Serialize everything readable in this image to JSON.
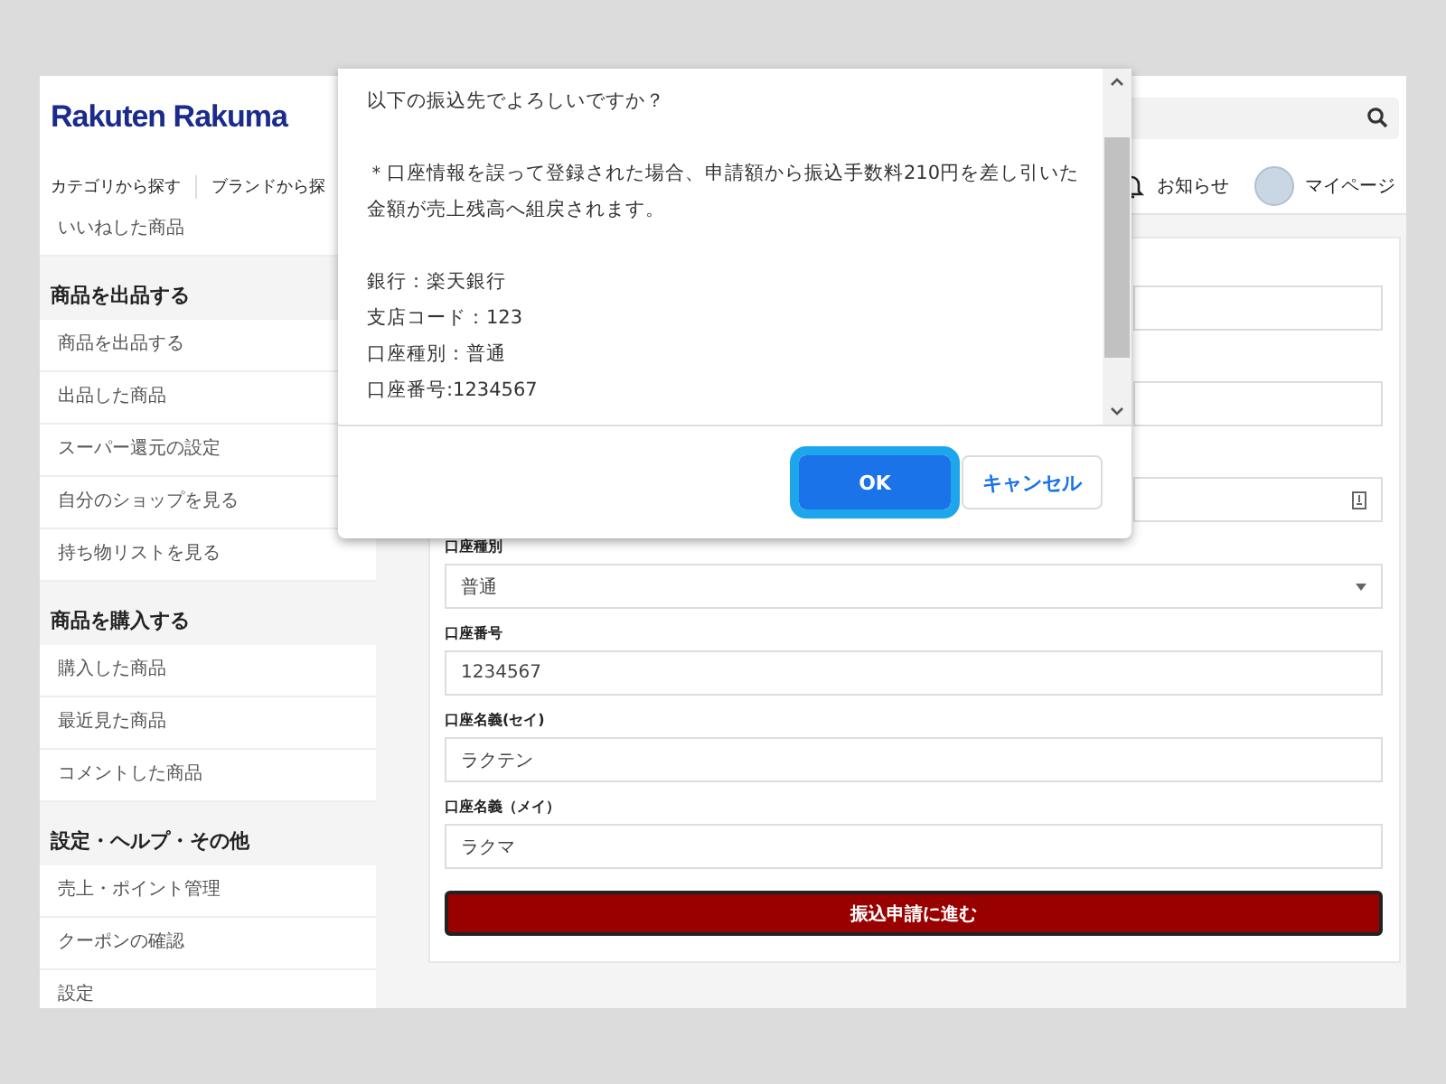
{
  "header": {
    "logo": "Rakuten Rakuma",
    "nav": [
      {
        "label": "カテゴリから探す"
      },
      {
        "label": "ブランドから探"
      }
    ],
    "notifications": "お知らせ",
    "mypage": "マイページ"
  },
  "sidebar": {
    "sections": [
      {
        "items": [
          "いいねした商品"
        ]
      },
      {
        "title": "商品を出品する",
        "items": [
          "商品を出品する",
          "出品した商品",
          "スーパー還元の設定",
          "自分のショップを見る",
          "持ち物リストを見る"
        ]
      },
      {
        "title": "商品を購入する",
        "items": [
          "購入した商品",
          "最近見た商品",
          "コメントした商品"
        ]
      },
      {
        "title": "設定・ヘルプ・その他",
        "items": [
          "売上・ポイント管理",
          "クーポンの確認",
          "設定"
        ]
      }
    ]
  },
  "form": {
    "covered_fields": [
      {
        "kind": "text"
      },
      {
        "kind": "text"
      },
      {
        "kind": "icon"
      }
    ],
    "fields": [
      {
        "label": "口座種別",
        "value": "普通",
        "kind": "select"
      },
      {
        "label": "口座番号",
        "value": "1234567",
        "kind": "text"
      },
      {
        "label": "口座名義(セイ)",
        "value": "ラクテン",
        "kind": "text"
      },
      {
        "label": "口座名義（メイ）",
        "value": "ラクマ",
        "kind": "text"
      }
    ],
    "submit": "振込申請に進む"
  },
  "dialog": {
    "paragraphs": [
      [
        "以下の振込先でよろしいですか？"
      ],
      [
        "＊口座情報を誤って登録された場合、申請額から振込手数料210円を差し引いた金額が売上残高へ組戻されます。"
      ],
      [
        "銀行：楽天銀行",
        "支店コード：123",
        "口座種別：普通",
        "口座番号:1234567"
      ]
    ],
    "buttons": [
      {
        "label": "OK",
        "focused": true
      },
      {
        "label": "キャンセル",
        "focused": false
      }
    ]
  }
}
